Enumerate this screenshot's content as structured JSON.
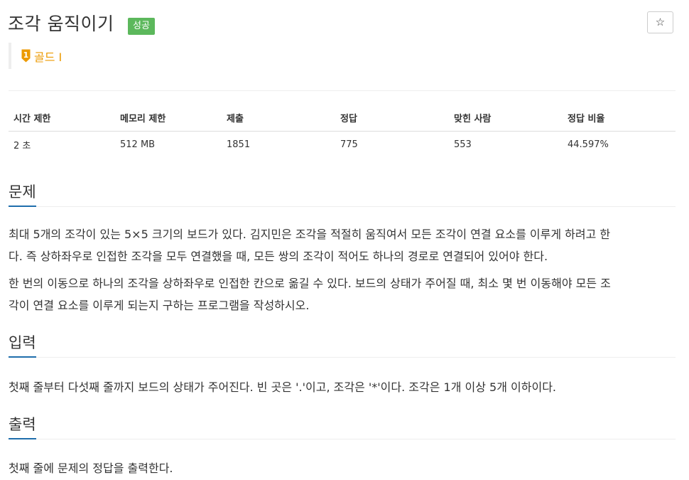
{
  "problem": {
    "title": "조각 움직이기",
    "status_badge": "성공",
    "star_icon": "star-outline-icon",
    "tier": {
      "label": "골드 I",
      "icon": "tier-gold-medal-icon",
      "icon_number": "1",
      "color": "#ec9a00"
    }
  },
  "stats": {
    "headers": [
      "시간 제한",
      "메모리 제한",
      "제출",
      "정답",
      "맞힌 사람",
      "정답 비율"
    ],
    "values": [
      "2 초",
      "512 MB",
      "1851",
      "775",
      "553",
      "44.597%"
    ]
  },
  "sections": {
    "description": {
      "title": "문제",
      "p1_line1": "최대 5개의 조각이 있는 5×5 크기의 보드가 있다. 김지민은 조각을 적절히 움직여서 모든 조각이 연결 요소를 이루게 하려고 한",
      "p1_line2": "다. 즉 상하좌우로 인접한 조각을 모두 연결했을 때, 모든 쌍의 조각이 적어도 하나의 경로로 연결되어 있어야 한다.",
      "p2_line1": "한 번의 이동으로 하나의 조각을 상하좌우로 인접한 칸으로 옮길 수 있다. 보드의 상태가 주어질 때, 최소 몇 번 이동해야 모든 조",
      "p2_line2": "각이 연결 요소를 이루게 되는지 구하는 프로그램을 작성하시오."
    },
    "input": {
      "title": "입력",
      "p1": "첫째 줄부터 다섯째 줄까지 보드의 상태가 주어진다. 빈 곳은 '.'이고, 조각은 '*'이다. 조각은 1개 이상 5개 이하이다."
    },
    "output": {
      "title": "출력",
      "p1": "첫째 줄에 문제의 정답을 출력한다."
    }
  },
  "colors": {
    "success": "#5cb85c",
    "accent": "#1f6eac",
    "tier_gold": "#ec9a00"
  }
}
